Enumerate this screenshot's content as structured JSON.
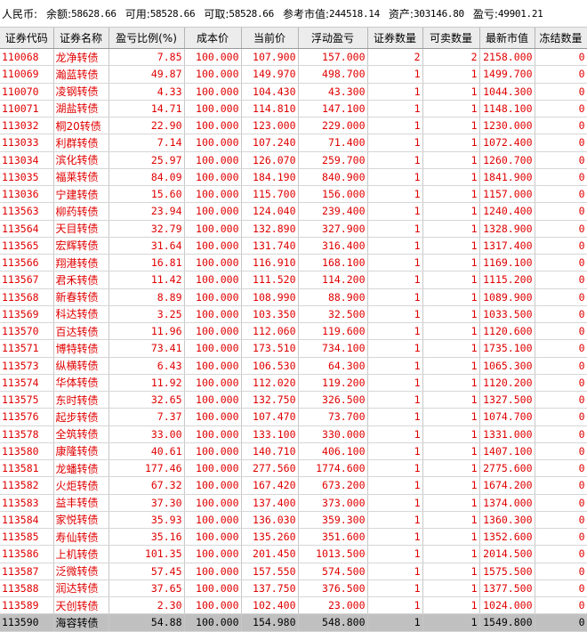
{
  "summary": {
    "currency": "人民币:",
    "balance_label": "余额:",
    "balance": "58628.66",
    "available_label": "可用:",
    "available": "58528.66",
    "withdrawable_label": "可取:",
    "withdrawable": "58528.66",
    "market_value_label": "参考市值:",
    "market_value": "244518.14",
    "assets_label": "资产:",
    "assets": "303146.80",
    "pnl_label": "盈亏:",
    "pnl": "49901.21"
  },
  "table": {
    "columns": [
      "证券代码",
      "证券名称",
      "盈亏比例(%)",
      "成本价",
      "当前价",
      "浮动盈亏",
      "证券数量",
      "可卖数量",
      "最新市值",
      "冻结数量"
    ],
    "rows": [
      [
        "110068",
        "龙净转债",
        "7.85",
        "100.000",
        "107.900",
        "157.000",
        "2",
        "2",
        "2158.000",
        "0"
      ],
      [
        "110069",
        "瀚蓝转债",
        "49.87",
        "100.000",
        "149.970",
        "498.700",
        "1",
        "1",
        "1499.700",
        "0"
      ],
      [
        "110070",
        "凌钢转债",
        "4.33",
        "100.000",
        "104.430",
        "43.300",
        "1",
        "1",
        "1044.300",
        "0"
      ],
      [
        "110071",
        "湖盐转债",
        "14.71",
        "100.000",
        "114.810",
        "147.100",
        "1",
        "1",
        "1148.100",
        "0"
      ],
      [
        "113032",
        "桐20转债",
        "22.90",
        "100.000",
        "123.000",
        "229.000",
        "1",
        "1",
        "1230.000",
        "0"
      ],
      [
        "113033",
        "利群转债",
        "7.14",
        "100.000",
        "107.240",
        "71.400",
        "1",
        "1",
        "1072.400",
        "0"
      ],
      [
        "113034",
        "滨化转债",
        "25.97",
        "100.000",
        "126.070",
        "259.700",
        "1",
        "1",
        "1260.700",
        "0"
      ],
      [
        "113035",
        "福莱转债",
        "84.09",
        "100.000",
        "184.190",
        "840.900",
        "1",
        "1",
        "1841.900",
        "0"
      ],
      [
        "113036",
        "宁建转债",
        "15.60",
        "100.000",
        "115.700",
        "156.000",
        "1",
        "1",
        "1157.000",
        "0"
      ],
      [
        "113563",
        "柳药转债",
        "23.94",
        "100.000",
        "124.040",
        "239.400",
        "1",
        "1",
        "1240.400",
        "0"
      ],
      [
        "113564",
        "天目转债",
        "32.79",
        "100.000",
        "132.890",
        "327.900",
        "1",
        "1",
        "1328.900",
        "0"
      ],
      [
        "113565",
        "宏辉转债",
        "31.64",
        "100.000",
        "131.740",
        "316.400",
        "1",
        "1",
        "1317.400",
        "0"
      ],
      [
        "113566",
        "翔港转债",
        "16.81",
        "100.000",
        "116.910",
        "168.100",
        "1",
        "1",
        "1169.100",
        "0"
      ],
      [
        "113567",
        "君禾转债",
        "11.42",
        "100.000",
        "111.520",
        "114.200",
        "1",
        "1",
        "1115.200",
        "0"
      ],
      [
        "113568",
        "新春转债",
        "8.89",
        "100.000",
        "108.990",
        "88.900",
        "1",
        "1",
        "1089.900",
        "0"
      ],
      [
        "113569",
        "科达转债",
        "3.25",
        "100.000",
        "103.350",
        "32.500",
        "1",
        "1",
        "1033.500",
        "0"
      ],
      [
        "113570",
        "百达转债",
        "11.96",
        "100.000",
        "112.060",
        "119.600",
        "1",
        "1",
        "1120.600",
        "0"
      ],
      [
        "113571",
        "博特转债",
        "73.41",
        "100.000",
        "173.510",
        "734.100",
        "1",
        "1",
        "1735.100",
        "0"
      ],
      [
        "113573",
        "纵横转债",
        "6.43",
        "100.000",
        "106.530",
        "64.300",
        "1",
        "1",
        "1065.300",
        "0"
      ],
      [
        "113574",
        "华体转债",
        "11.92",
        "100.000",
        "112.020",
        "119.200",
        "1",
        "1",
        "1120.200",
        "0"
      ],
      [
        "113575",
        "东时转债",
        "32.65",
        "100.000",
        "132.750",
        "326.500",
        "1",
        "1",
        "1327.500",
        "0"
      ],
      [
        "113576",
        "起步转债",
        "7.37",
        "100.000",
        "107.470",
        "73.700",
        "1",
        "1",
        "1074.700",
        "0"
      ],
      [
        "113578",
        "全筑转债",
        "33.00",
        "100.000",
        "133.100",
        "330.000",
        "1",
        "1",
        "1331.000",
        "0"
      ],
      [
        "113580",
        "康隆转债",
        "40.61",
        "100.000",
        "140.710",
        "406.100",
        "1",
        "1",
        "1407.100",
        "0"
      ],
      [
        "113581",
        "龙蟠转债",
        "177.46",
        "100.000",
        "277.560",
        "1774.600",
        "1",
        "1",
        "2775.600",
        "0"
      ],
      [
        "113582",
        "火炬转债",
        "67.32",
        "100.000",
        "167.420",
        "673.200",
        "1",
        "1",
        "1674.200",
        "0"
      ],
      [
        "113583",
        "益丰转债",
        "37.30",
        "100.000",
        "137.400",
        "373.000",
        "1",
        "1",
        "1374.000",
        "0"
      ],
      [
        "113584",
        "家悦转债",
        "35.93",
        "100.000",
        "136.030",
        "359.300",
        "1",
        "1",
        "1360.300",
        "0"
      ],
      [
        "113585",
        "寿仙转债",
        "35.16",
        "100.000",
        "135.260",
        "351.600",
        "1",
        "1",
        "1352.600",
        "0"
      ],
      [
        "113586",
        "上机转债",
        "101.35",
        "100.000",
        "201.450",
        "1013.500",
        "1",
        "1",
        "2014.500",
        "0"
      ],
      [
        "113587",
        "泛微转债",
        "57.45",
        "100.000",
        "157.550",
        "574.500",
        "1",
        "1",
        "1575.500",
        "0"
      ],
      [
        "113588",
        "润达转债",
        "37.65",
        "100.000",
        "137.750",
        "376.500",
        "1",
        "1",
        "1377.500",
        "0"
      ],
      [
        "113589",
        "天创转债",
        "2.30",
        "100.000",
        "102.400",
        "23.000",
        "1",
        "1",
        "1024.000",
        "0"
      ],
      [
        "113590",
        "海容转债",
        "54.88",
        "100.000",
        "154.980",
        "548.800",
        "1",
        "1",
        "1549.800",
        "0"
      ]
    ],
    "selected_row_index": 33
  },
  "colors": {
    "text_red": "#e00000",
    "header_bg": "#ececec",
    "selected_bg": "#c0c0c0"
  }
}
